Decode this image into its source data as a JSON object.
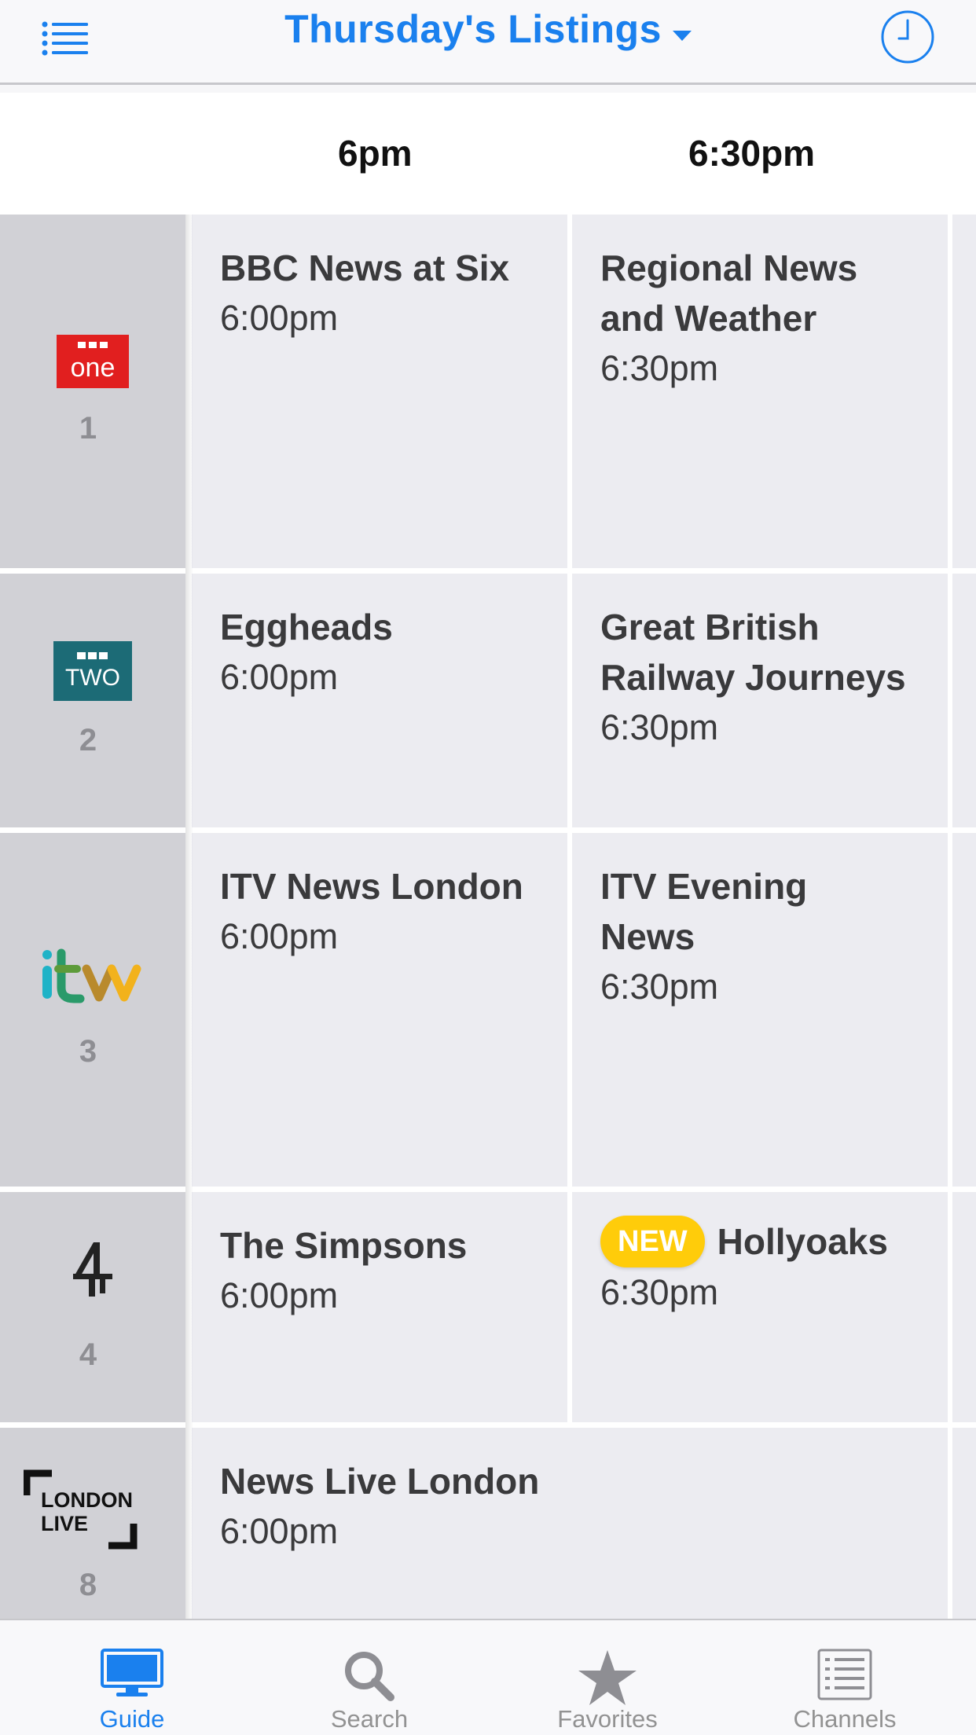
{
  "header": {
    "title": "Thursday's Listings",
    "menu_icon": "list-menu-icon",
    "clock_icon": "clock-icon",
    "accent_color": "#1a80ee"
  },
  "time_slots": [
    "6pm",
    "6:30pm"
  ],
  "channels": [
    {
      "number": "1",
      "logo": {
        "name": "bbc-one-logo",
        "text": "one",
        "color": "#e11f1f"
      },
      "programs": [
        {
          "title": "BBC News at Six",
          "time": "6:00pm"
        },
        {
          "title": "Regional News and Weather",
          "time": "6:30pm"
        }
      ]
    },
    {
      "number": "2",
      "logo": {
        "name": "bbc-two-logo",
        "text": "TWO",
        "small": "BBC",
        "color": "#1c6b76"
      },
      "programs": [
        {
          "title": "Eggheads",
          "time": "6:00pm"
        },
        {
          "title": "Great British Railway Journeys",
          "time": "6:30pm"
        }
      ]
    },
    {
      "number": "3",
      "logo": {
        "name": "itv-logo",
        "text": "itv"
      },
      "programs": [
        {
          "title": "ITV News London",
          "time": "6:00pm"
        },
        {
          "title": "ITV Evening News",
          "time": "6:30pm"
        }
      ]
    },
    {
      "number": "4",
      "logo": {
        "name": "channel-4-logo",
        "text": "4"
      },
      "programs": [
        {
          "title": "The Simpsons",
          "time": "6:00pm"
        },
        {
          "title": "Hollyoaks",
          "time": "6:30pm",
          "badge": "NEW"
        }
      ]
    },
    {
      "number": "8",
      "logo": {
        "name": "london-live-logo",
        "line1": "LONDON",
        "line2": "LIVE"
      },
      "programs": [
        {
          "title": "News Live London",
          "time": "6:00pm"
        }
      ]
    }
  ],
  "tabs": [
    {
      "label": "Guide",
      "icon": "tv-monitor-icon",
      "active": true
    },
    {
      "label": "Search",
      "icon": "search-icon",
      "active": false
    },
    {
      "label": "Favorites",
      "icon": "star-icon",
      "active": false
    },
    {
      "label": "Channels",
      "icon": "channel-list-icon",
      "active": false
    }
  ],
  "colors": {
    "badge": "#ffcc0a",
    "channel_column": "#d1d1d6",
    "program_cell": "#ececf1"
  }
}
